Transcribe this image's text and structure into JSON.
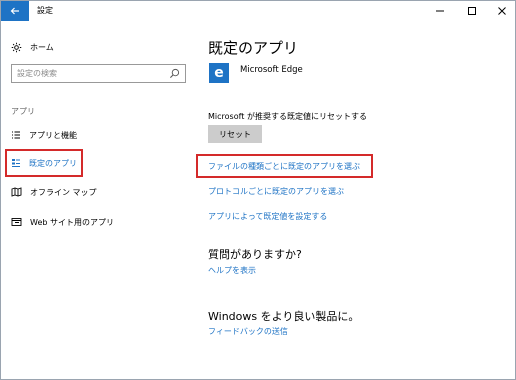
{
  "window": {
    "title": "設定"
  },
  "sidebar": {
    "home_label": "ホーム",
    "search_placeholder": "設定の検索",
    "section_label": "アプリ",
    "items": [
      {
        "label": "アプリと機能",
        "icon": "list-icon"
      },
      {
        "label": "既定のアプリ",
        "icon": "default-apps-icon",
        "active": true
      },
      {
        "label": "オフライン マップ",
        "icon": "map-icon"
      },
      {
        "label": "Web サイト用のアプリ",
        "icon": "web-apps-icon"
      }
    ]
  },
  "main": {
    "title": "既定のアプリ",
    "browser_app": "Microsoft Edge",
    "reset_description": "Microsoft が推奨する既定値にリセットする",
    "reset_button": "リセット",
    "links": [
      "ファイルの種類ごとに既定のアプリを選ぶ",
      "プロトコルごとに既定のアプリを選ぶ",
      "アプリによって既定値を設定する"
    ],
    "question_heading": "質問がありますか?",
    "help_link": "ヘルプを表示",
    "windows_heading": "Windows をより良い製品に。",
    "feedback_link": "フィードバックの送信"
  },
  "colors": {
    "accent": "#1e73c5",
    "highlight_box": "#d42a2a",
    "button_bg": "#cccccc"
  }
}
